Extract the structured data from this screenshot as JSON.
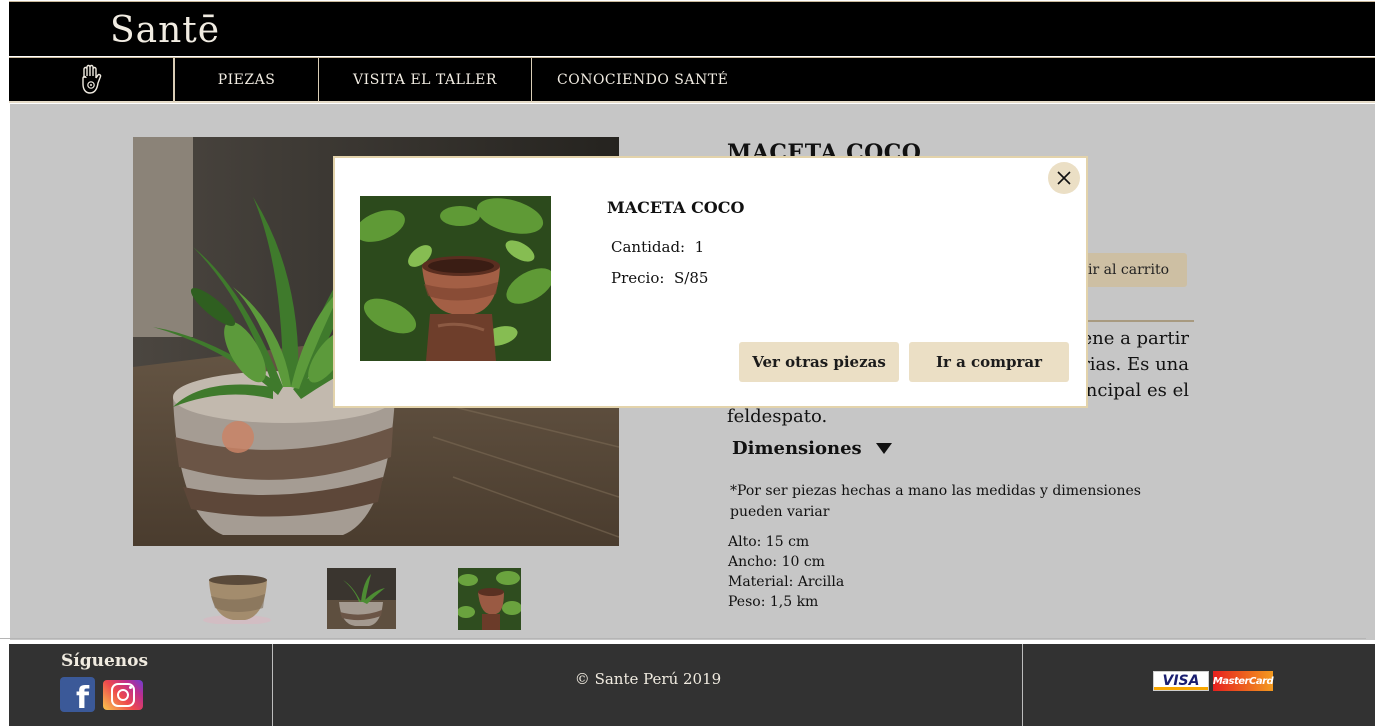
{
  "header": {
    "brand": "Santē"
  },
  "nav": {
    "home_icon": "hamsa-hand-icon",
    "items": [
      {
        "label": "PIEZAS"
      },
      {
        "label": "VISITA EL TALLER"
      },
      {
        "label": "CONOCIENDO SANTÉ"
      }
    ]
  },
  "product": {
    "title": "MACETA COCO",
    "add_to_cart_label": "Añadir al carrito",
    "description_lines": [
      "…iene a partir",
      "…arias. Es una",
      "…incipal  es el",
      "feldespato."
    ],
    "dimensions_label": "Dimensiones",
    "note": "*Por  ser piezas hechas a mano las medidas y dimensiones pueden variar",
    "specs": {
      "alto": "Alto: 15 cm",
      "ancho": "Ancho: 10 cm",
      "material": "Material:  Arcilla",
      "peso": "Peso:  1,5 km"
    }
  },
  "modal": {
    "title": "MACETA COCO",
    "quantity_label": "Cantidad:",
    "quantity_value": "1",
    "price_label": "Precio:",
    "price_value": "S/85",
    "view_other_label": "Ver otras piezas",
    "buy_label": "Ir a comprar",
    "close_icon": "close-icon"
  },
  "footer": {
    "follow_label": "Síguenos",
    "copyright": "© Sante Perú 2019",
    "social_icons": [
      "facebook-icon",
      "instagram-icon"
    ],
    "visa_label": "VISA",
    "mastercard_label": "MasterCard"
  }
}
